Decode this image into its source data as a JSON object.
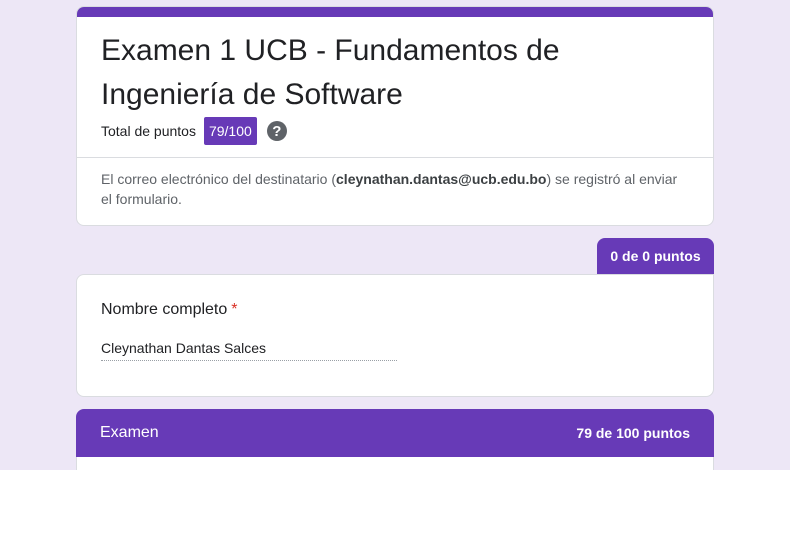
{
  "form": {
    "title": "Examen 1 UCB - Fundamentos de Ingeniería de Software",
    "total_label": "Total de puntos",
    "total_score": "79/100",
    "help_icon": "help-circle-icon",
    "email_prefix": "El correo electrónico del destinatario (",
    "email": "cleynathan.dantas@ucb.edu.bo",
    "email_suffix": ") se registró al enviar el formulario."
  },
  "name_section": {
    "points": "0 de 0 puntos",
    "question": "Nombre completo",
    "required_mark": "*",
    "answer": "Cleynathan Dantas Salces"
  },
  "exam_section": {
    "title": "Examen",
    "points": "79 de 100 puntos"
  },
  "colors": {
    "accent": "#673ab7",
    "background": "#ede7f6",
    "required": "#d93025"
  }
}
